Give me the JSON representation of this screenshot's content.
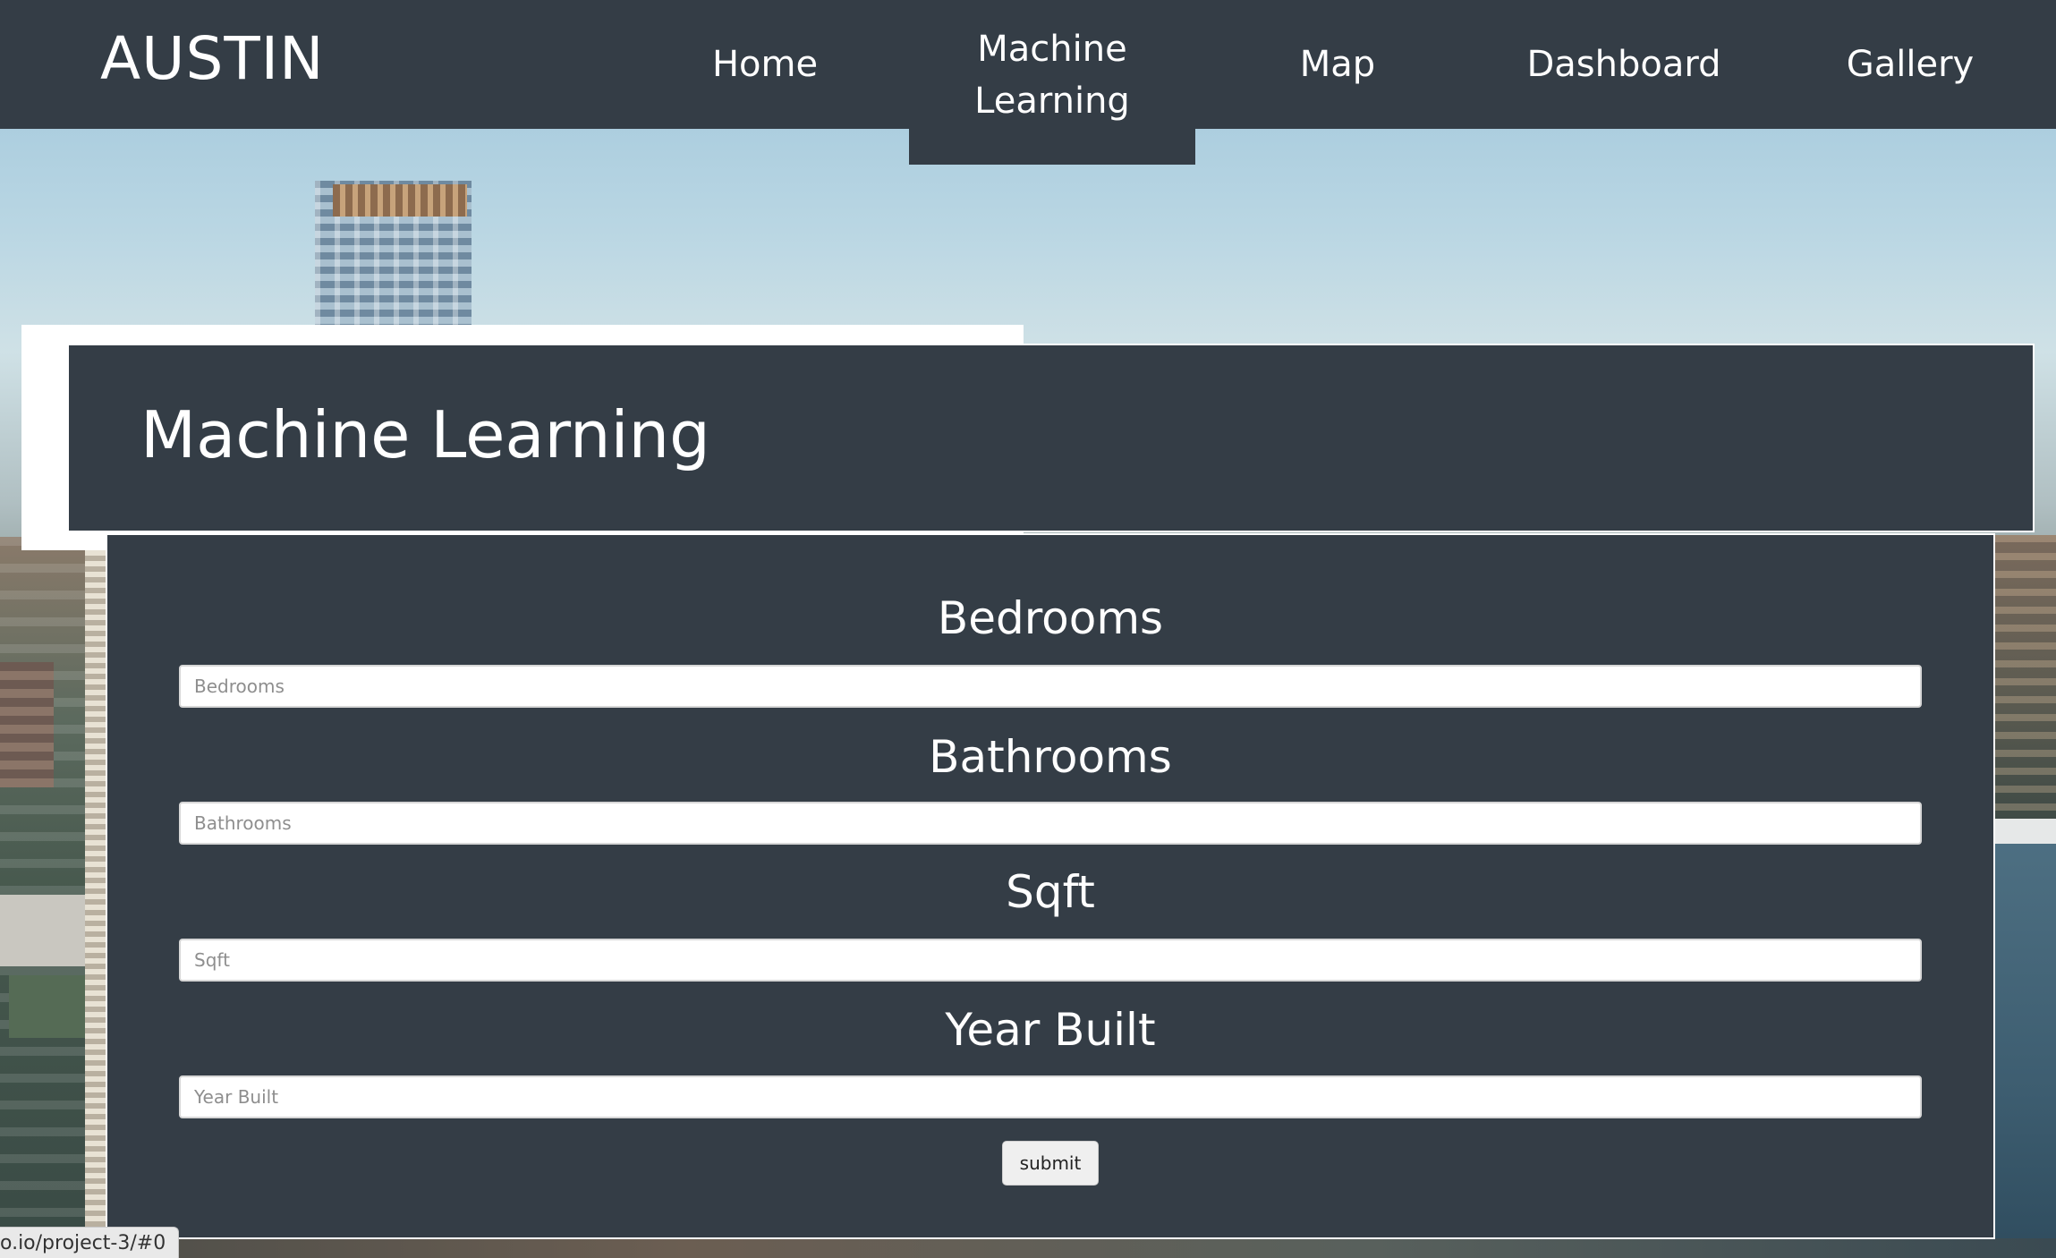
{
  "navbar": {
    "brand": "AUSTIN",
    "items": [
      {
        "label": "Home"
      },
      {
        "label": "Machine Learning",
        "active": true
      },
      {
        "label": "Map"
      },
      {
        "label": "Dashboard"
      },
      {
        "label": "Gallery"
      }
    ]
  },
  "header": {
    "title": "Machine Learning"
  },
  "form": {
    "fields": [
      {
        "label": "Bedrooms",
        "placeholder": "Bedrooms",
        "value": ""
      },
      {
        "label": "Bathrooms",
        "placeholder": "Bathrooms",
        "value": ""
      },
      {
        "label": "Sqft",
        "placeholder": "Sqft",
        "value": ""
      },
      {
        "label": "Year Built",
        "placeholder": "Year Built",
        "value": ""
      }
    ],
    "submit_label": "submit"
  },
  "status_bar": {
    "url": "o.io/project-3/#0"
  },
  "colors": {
    "panel": "#343d46",
    "text": "#ffffff",
    "input_bg": "#ffffff",
    "button_bg": "#efefef"
  }
}
